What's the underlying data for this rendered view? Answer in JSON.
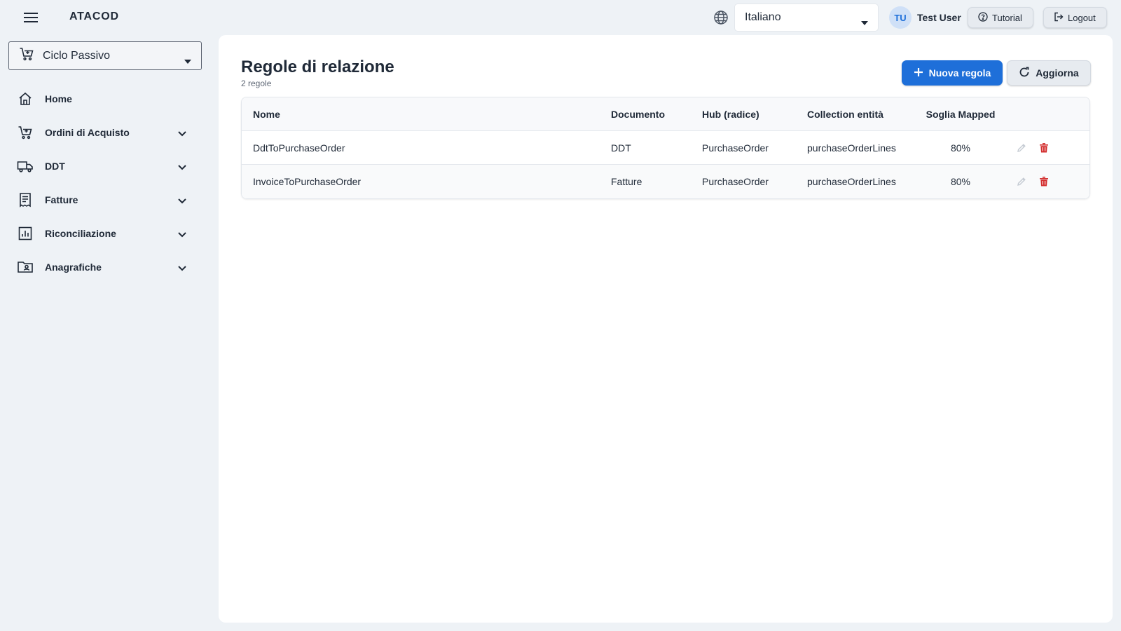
{
  "app": {
    "brand": "ATACOD"
  },
  "header": {
    "language": "Italiano",
    "user_initials": "TU",
    "user_name": "Test User",
    "tutorial_label": "Tutorial",
    "logout_label": "Logout"
  },
  "sidebar": {
    "cycle_select": "Ciclo Passivo",
    "items": [
      {
        "label": "Home",
        "icon": "home-icon",
        "expandable": false
      },
      {
        "label": "Ordini di Acquisto",
        "icon": "cart-icon",
        "expandable": true
      },
      {
        "label": "DDT",
        "icon": "truck-icon",
        "expandable": true
      },
      {
        "label": "Fatture",
        "icon": "receipt-icon",
        "expandable": true
      },
      {
        "label": "Riconciliazione",
        "icon": "chart-icon",
        "expandable": true
      },
      {
        "label": "Anagrafiche",
        "icon": "folder-user-icon",
        "expandable": true
      }
    ]
  },
  "main": {
    "title": "Regole di relazione",
    "subtitle": "2 regole",
    "new_rule_label": "Nuova regola",
    "refresh_label": "Aggiorna",
    "table": {
      "columns": [
        "Nome",
        "Documento",
        "Hub (radice)",
        "Collection entità",
        "Soglia Mapped"
      ],
      "rows": [
        [
          "DdtToPurchaseOrder",
          "DDT",
          "PurchaseOrder",
          "purchaseOrderLines",
          "80%"
        ],
        [
          "InvoiceToPurchaseOrder",
          "Fatture",
          "PurchaseOrder",
          "purchaseOrderLines",
          "80%"
        ]
      ]
    }
  },
  "colors": {
    "accent": "#1e6fd9",
    "danger": "#d32f2f",
    "background": "#eef2f6",
    "surface": "#ffffff"
  }
}
